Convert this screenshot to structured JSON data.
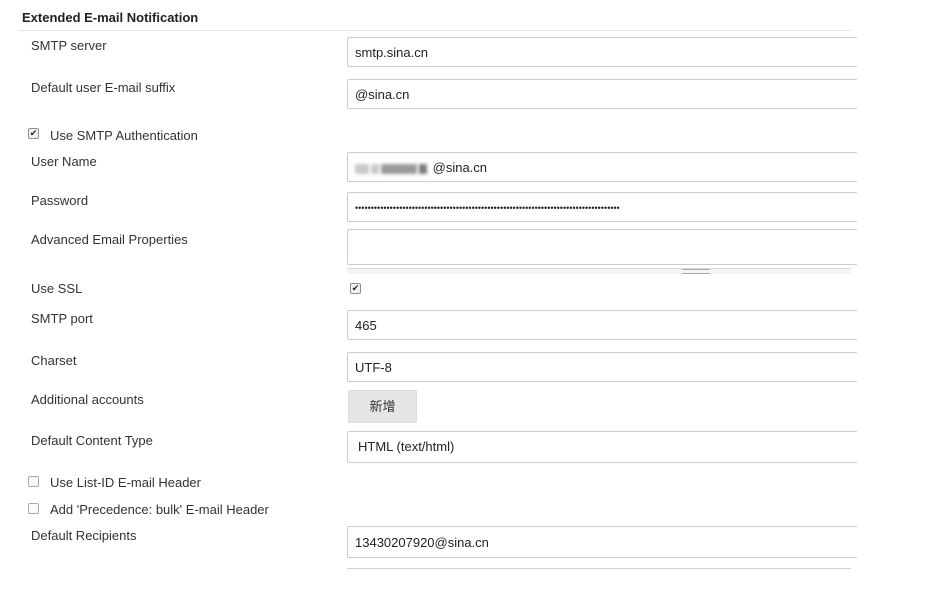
{
  "section": {
    "title": "Extended E-mail Notification"
  },
  "fields": {
    "smtp_server": {
      "label": "SMTP server",
      "value": "smtp.sina.cn"
    },
    "email_suffix": {
      "label": "Default user E-mail suffix",
      "value": "@sina.cn"
    },
    "use_smtp_auth": {
      "label": "Use SMTP Authentication",
      "checked": true
    },
    "user_name": {
      "label": "User Name",
      "value": "@sina.cn"
    },
    "password": {
      "label": "Password",
      "value": "••••••••••••••••••••••••••••••••••••••••••••••••••••••••••••••••••••••••••••••••••••"
    },
    "advanced_props": {
      "label": "Advanced Email Properties",
      "value": ""
    },
    "use_ssl": {
      "label": "Use SSL",
      "checked": true
    },
    "smtp_port": {
      "label": "SMTP port",
      "value": "465"
    },
    "charset": {
      "label": "Charset",
      "value": "UTF-8"
    },
    "additional_accounts": {
      "label": "Additional accounts",
      "button_label": "新增"
    },
    "content_type": {
      "label": "Default Content Type",
      "value": "HTML (text/html)"
    },
    "list_id_header": {
      "label": "Use List-ID E-mail Header",
      "checked": false
    },
    "precedence_header": {
      "label": "Add 'Precedence: bulk' E-mail Header",
      "checked": false
    },
    "recipients": {
      "label": "Default Recipients",
      "value": "13430207920@sina.cn"
    }
  }
}
